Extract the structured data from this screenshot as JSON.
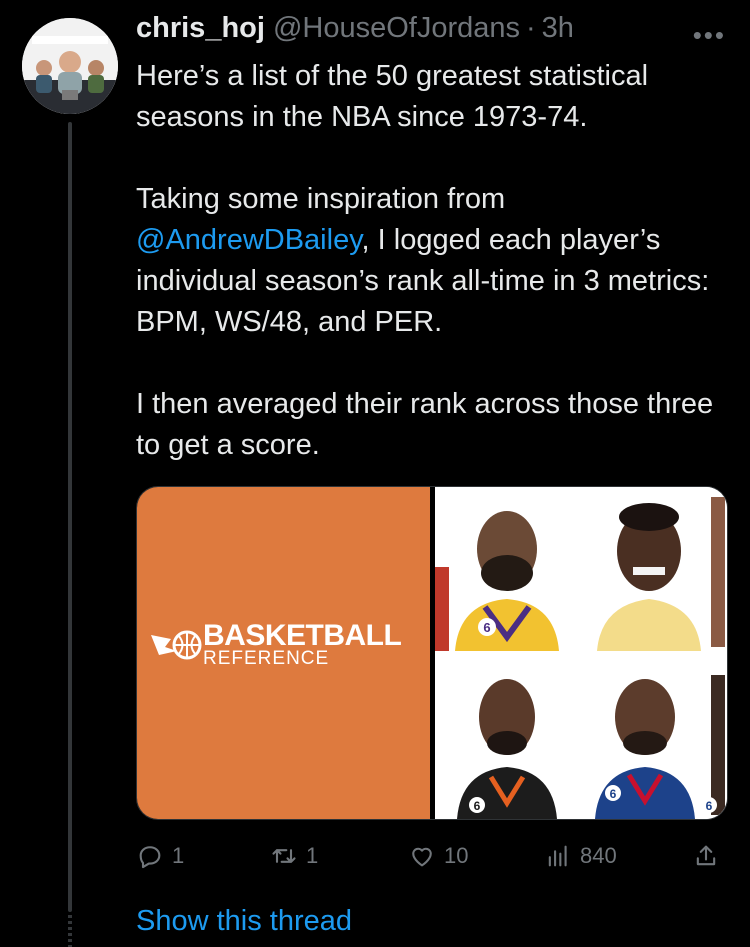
{
  "tweet": {
    "display_name": "chris_hoj",
    "handle": "@HouseOfJordans",
    "separator": "·",
    "time": "3h",
    "more_label": "•••",
    "paragraph1": "Here’s a list of the 50 greatest statistical seasons in the NBA since 1973-74.",
    "p2_before": "Taking some inspiration from ",
    "p2_mention": "@AndrewDBailey",
    "p2_after": ", I logged each player’s individual season’s rank all-time in 3 metrics: BPM, WS/48, and PER.",
    "paragraph3": "I then averaged their rank across those three to get a score."
  },
  "media": {
    "logo_line1": "BASKETBALL",
    "logo_line2": "REFERENCE",
    "jersey_numbers": [
      "6",
      "6",
      "6",
      "6"
    ],
    "colors": {
      "logo_bg": "#de7a3e"
    }
  },
  "actions": {
    "reply_count": "1",
    "retweet_count": "1",
    "like_count": "10",
    "views_count": "840"
  },
  "footer": {
    "show_thread": "Show this thread"
  },
  "colors": {
    "accent": "#1d9bf0",
    "muted": "#71767b",
    "text": "#e7e9ea",
    "background": "#000000"
  }
}
